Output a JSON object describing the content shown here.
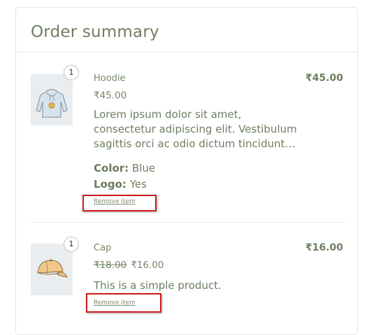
{
  "summary": {
    "title": "Order summary"
  },
  "items": [
    {
      "quantity": "1",
      "name": "Hoodie",
      "price": "₹45.00",
      "description": "Lorem ipsum dolor sit amet, consectetur adipiscing elit. Vestibulum sagittis orci ac odio dictum tincidunt…",
      "attributes": [
        {
          "label": "Color:",
          "value": "Blue"
        },
        {
          "label": "Logo:",
          "value": "Yes"
        }
      ],
      "remove_label": "Remove item",
      "total": "₹45.00",
      "image_icon": "hoodie-image"
    },
    {
      "quantity": "1",
      "name": "Cap",
      "regular_price": "₹18.00",
      "sale_price": "₹16.00",
      "description": "This is a simple product.",
      "remove_label": "Remove item",
      "total": "₹16.00",
      "image_icon": "cap-image"
    }
  ],
  "colors": {
    "highlight_box": "#d01a1a",
    "text": "#6e7e62"
  }
}
